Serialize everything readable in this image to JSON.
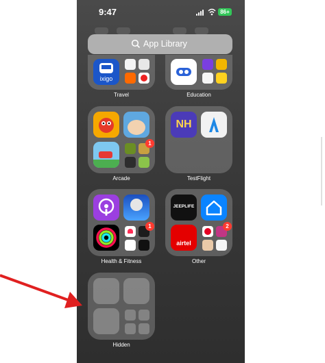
{
  "status_bar": {
    "time": "9:47",
    "battery": "86+"
  },
  "search": {
    "placeholder": "App Library"
  },
  "folders": {
    "travel": {
      "label": "Travel",
      "app": "ixigo"
    },
    "education": {
      "label": "Education"
    },
    "arcade": {
      "label": "Arcade",
      "badge": "1"
    },
    "testflight": {
      "label": "TestFlight",
      "apps": [
        "NH",
        "TestFlight"
      ]
    },
    "health": {
      "label": "Health & Fitness",
      "badge": "1"
    },
    "other": {
      "label": "Other",
      "apps": [
        "JEEPLIFE",
        "airtel"
      ],
      "badge": "2"
    },
    "hidden": {
      "label": "Hidden"
    }
  },
  "colors": {
    "annotation_arrow": "#e02020",
    "battery": "#33c759",
    "badge": "#ff3b30"
  }
}
